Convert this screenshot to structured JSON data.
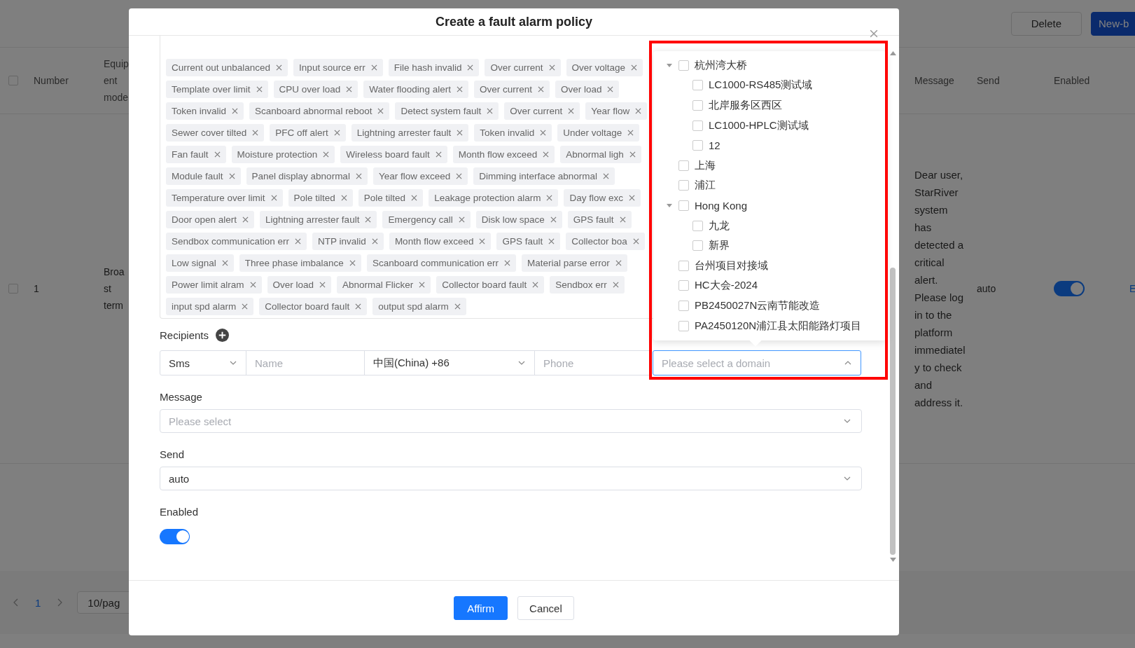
{
  "background_page": {
    "toolbar": {
      "buttons": [
        {
          "label": "Delete",
          "kind": "default"
        },
        {
          "label": "New-b",
          "kind": "primary"
        }
      ]
    },
    "table": {
      "header_checked": false,
      "columns": [
        "Number",
        "Equip ent mode",
        "Message",
        "Send",
        "Enabled"
      ],
      "rows": [
        {
          "checked": false,
          "number": "1",
          "equipment": "Broa st term",
          "message": "Dear user, StarRiver system has detected a critical alert. Please log in to the platform immediately to check and address it.",
          "send": "auto",
          "enabled": true,
          "action": "E"
        }
      ]
    },
    "pagination": {
      "page": "1",
      "page_size": "10/pag"
    }
  },
  "modal": {
    "title": "Create a fault alarm policy",
    "alarm_tags": [
      [
        {
          "label": "Current out unbalanced"
        },
        {
          "label": "Input source err"
        },
        {
          "label": "File hash invalid"
        },
        {
          "label": "Over current"
        },
        {
          "label": "Over voltage"
        }
      ],
      [
        {
          "label": "Template over limit"
        },
        {
          "label": "CPU over load"
        },
        {
          "label": "Water flooding alert"
        },
        {
          "label": "Over current"
        },
        {
          "label": "Over load"
        }
      ],
      [
        {
          "label": "Token invalid"
        },
        {
          "label": "Scanboard abnormal reboot"
        },
        {
          "label": "Detect system fault"
        },
        {
          "label": "Over current"
        },
        {
          "label": "Year flow"
        }
      ],
      [
        {
          "label": "Sewer cover tilted"
        },
        {
          "label": "PFC off alert"
        },
        {
          "label": "Lightning arrester fault"
        },
        {
          "label": "Token invalid"
        },
        {
          "label": "Under voltage"
        }
      ],
      [
        {
          "label": "Fan fault"
        },
        {
          "label": "Moisture protection"
        },
        {
          "label": "Wireless board fault"
        },
        {
          "label": "Month flow exceed"
        },
        {
          "label": "Abnormal ligh"
        }
      ],
      [
        {
          "label": "Module fault"
        },
        {
          "label": "Panel display abnormal"
        },
        {
          "label": "Year flow exceed"
        },
        {
          "label": "Dimming interface abnormal"
        }
      ],
      [
        {
          "label": "Temperature over limit"
        },
        {
          "label": "Pole tilted"
        },
        {
          "label": "Pole tilted"
        },
        {
          "label": "Leakage protection alarm"
        },
        {
          "label": "Day flow exc"
        }
      ],
      [
        {
          "label": "Door open alert"
        },
        {
          "label": "Lightning arrester fault"
        },
        {
          "label": "Emergency call"
        },
        {
          "label": "Disk low space"
        },
        {
          "label": "GPS fault"
        }
      ],
      [
        {
          "label": "Sendbox communication err"
        },
        {
          "label": "NTP invalid"
        },
        {
          "label": "Month flow exceed"
        },
        {
          "label": "GPS fault"
        },
        {
          "label": "Collector boa"
        }
      ],
      [
        {
          "label": "Low signal"
        },
        {
          "label": "Three phase imbalance"
        },
        {
          "label": "Scanboard communication err"
        },
        {
          "label": "Material parse error"
        }
      ],
      [
        {
          "label": "Power limit alram"
        },
        {
          "label": "Over load"
        },
        {
          "label": "Abnormal Flicker"
        },
        {
          "label": "Collector board fault"
        },
        {
          "label": "Sendbox err"
        }
      ],
      [
        {
          "label": "input spd alarm"
        },
        {
          "label": "Collector board fault"
        },
        {
          "label": "output spd alarm"
        }
      ]
    ],
    "recipients": {
      "label": "Recipients",
      "channel": "Sms",
      "name_placeholder": "Name",
      "country": "中国(China)  +86",
      "phone_placeholder": "Phone",
      "domain_placeholder": "Please select a domain",
      "domain_open": true
    },
    "domain_tree": [
      {
        "label": "杭州湾大桥",
        "checked": false,
        "expanded": true,
        "children": [
          {
            "label": "LC1000-RS485测试域",
            "checked": false
          },
          {
            "label": "北岸服务区西区",
            "checked": false
          },
          {
            "label": "LC1000-HPLC测试域",
            "checked": false
          },
          {
            "label": "12",
            "checked": false
          }
        ]
      },
      {
        "label": "上海",
        "checked": false
      },
      {
        "label": "浦江",
        "checked": false
      },
      {
        "label": "Hong Kong",
        "checked": false,
        "expanded": true,
        "children": [
          {
            "label": "九龙",
            "checked": false
          },
          {
            "label": "新界",
            "checked": false
          }
        ]
      },
      {
        "label": "台州项目对接域",
        "checked": false
      },
      {
        "label": "HC大会-2024",
        "checked": false
      },
      {
        "label": "PB2450027N云南节能改造",
        "checked": false
      },
      {
        "label": "PA2450120N浦江县太阳能路灯项目",
        "checked": false
      }
    ],
    "message": {
      "label": "Message",
      "placeholder": "Please select"
    },
    "send": {
      "label": "Send",
      "value": "auto"
    },
    "enabled": {
      "label": "Enabled",
      "on": true
    },
    "buttons": [
      {
        "label": "Affirm",
        "kind": "primary"
      },
      {
        "label": "Cancel",
        "kind": "default"
      }
    ]
  }
}
